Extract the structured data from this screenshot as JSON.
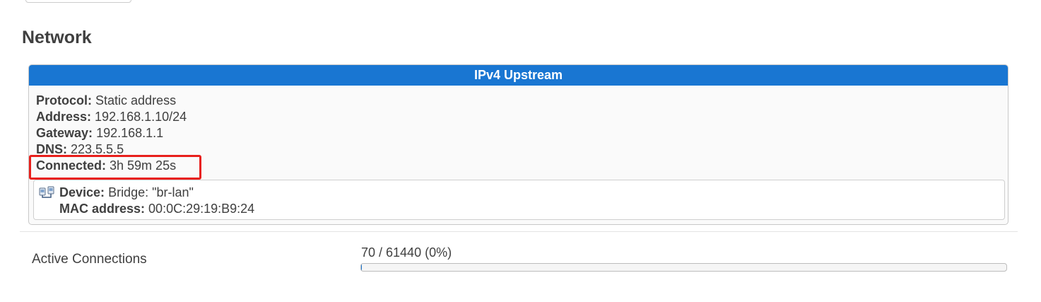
{
  "section": {
    "title": "Network"
  },
  "ipv4_upstream": {
    "header": "IPv4 Upstream",
    "protocol_label": "Protocol:",
    "protocol_value": "Static address",
    "address_label": "Address:",
    "address_value": "192.168.1.10/24",
    "gateway_label": "Gateway:",
    "gateway_value": "192.168.1.1",
    "dns_label": "DNS:",
    "dns_value": "223.5.5.5",
    "connected_label": "Connected:",
    "connected_value": "3h 59m 25s",
    "highlight_color": "#e8201c",
    "device": {
      "icon": "network-bridge-icon",
      "device_label": "Device:",
      "device_value": "Bridge: \"br-lan\"",
      "mac_label": "MAC address:",
      "mac_value": "00:0C:29:19:B9:24"
    }
  },
  "active_connections": {
    "label": "Active Connections",
    "progress_text": "70 / 61440 (0%)",
    "current": 70,
    "max": 61440,
    "fraction": 0.00114
  },
  "colors": {
    "accent": "#1976d2",
    "text": "#404040"
  }
}
